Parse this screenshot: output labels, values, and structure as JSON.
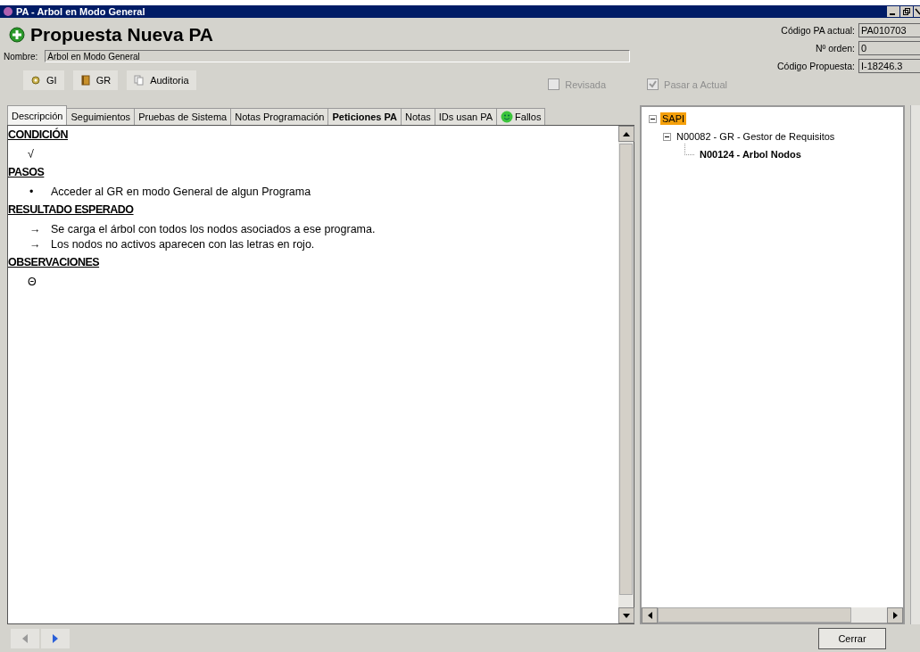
{
  "window": {
    "title": "PA - Arbol en Modo General"
  },
  "header": {
    "title": "Propuesta Nueva PA",
    "name_label": "Nombre:",
    "name_value": "Árbol en Modo General",
    "buttons": [
      {
        "label": "GI"
      },
      {
        "label": "GR"
      },
      {
        "label": "Auditoria"
      }
    ],
    "checkboxes": [
      {
        "label": "Revisada",
        "checked": false,
        "disabled": true
      },
      {
        "label": "Pasar a Actual",
        "checked": true,
        "disabled": true
      }
    ],
    "fields": [
      {
        "label": "Código PA actual:",
        "value": "PA010703"
      },
      {
        "label": "Nº orden:",
        "value": "0"
      },
      {
        "label": "Código Propuesta:",
        "value": "I-18246.3"
      }
    ]
  },
  "tabs": [
    {
      "label": "Descripción",
      "selected": true,
      "bold": false,
      "icon": false
    },
    {
      "label": "Seguimientos",
      "selected": false,
      "bold": false,
      "icon": false
    },
    {
      "label": "Pruebas de Sistema",
      "selected": false,
      "bold": false,
      "icon": false
    },
    {
      "label": "Notas Programación",
      "selected": false,
      "bold": false,
      "icon": false
    },
    {
      "label": "Peticiones PA",
      "selected": false,
      "bold": true,
      "icon": false
    },
    {
      "label": "Notas",
      "selected": false,
      "bold": false,
      "icon": false
    },
    {
      "label": "IDs usan PA",
      "selected": false,
      "bold": false,
      "icon": false
    },
    {
      "label": "Fallos",
      "selected": false,
      "bold": false,
      "icon": true
    }
  ],
  "document": [
    {
      "heading": "CONDICIÓN",
      "items": [
        {
          "kind": "check",
          "marker": "√"
        }
      ]
    },
    {
      "heading": "PASOS",
      "items": [
        {
          "kind": "bullet",
          "marker": "•",
          "text": "Acceder al GR en modo General de algun Programa"
        }
      ]
    },
    {
      "heading": "RESULTADO ESPERADO",
      "items": [
        {
          "kind": "arrow",
          "marker": "→",
          "text": "Se carga el árbol con todos los nodos asociados a ese programa."
        },
        {
          "kind": "arrow",
          "marker": "→",
          "text": "Los nodos no activos aparecen con las letras en rojo."
        }
      ]
    },
    {
      "heading": "OBSERVACIONES",
      "items": [
        {
          "kind": "theta",
          "marker": "Θ"
        }
      ]
    }
  ],
  "tree": [
    {
      "label": "SAPI",
      "selected": true,
      "expanded": true,
      "bold": false,
      "children": [
        {
          "label": "N00082 - GR - Gestor de Requisitos",
          "selected": false,
          "expanded": true,
          "bold": false,
          "children": [
            {
              "label": "N00124 - Arbol Nodos",
              "selected": false,
              "bold": true
            }
          ]
        }
      ]
    }
  ],
  "footer": {
    "close_button": "Cerrar"
  }
}
